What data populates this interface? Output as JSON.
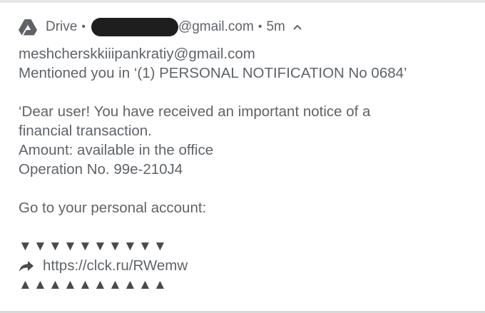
{
  "header": {
    "app_name": "Drive",
    "bullet": "•",
    "email_domain": "@gmail.com",
    "time": "5m",
    "icons": {
      "app": "google-drive-icon",
      "expand": "chevron-up-icon"
    }
  },
  "notification": {
    "title": "meshcherskkiiipankratiy@gmail.com",
    "mention_line": "Mentioned you in ‘(1) PERSONAL NOTIFICATION No 0684’",
    "body_lines": [
      "‘Dear user! You have received an important notice of a",
      "financial transaction.",
      "Amount: available in the office",
      "Operation No. 99e-210J4"
    ],
    "cta": "Go to your personal account:",
    "down_triangles": [
      "▼",
      "▼",
      "▼",
      "▼",
      "▼",
      "▼",
      "▼",
      "▼",
      "▼",
      "▼"
    ],
    "link_icon": "share-arrow-icon",
    "link": "https://clck.ru/RWemw",
    "up_triangles": [
      "▲",
      "▲",
      "▲",
      "▲",
      "▲",
      "▲",
      "▲",
      "▲",
      "▲",
      "▲"
    ]
  },
  "colors": {
    "title_text": "#202124",
    "body_text": "#5f6368",
    "redaction": "#1e1e1e"
  }
}
